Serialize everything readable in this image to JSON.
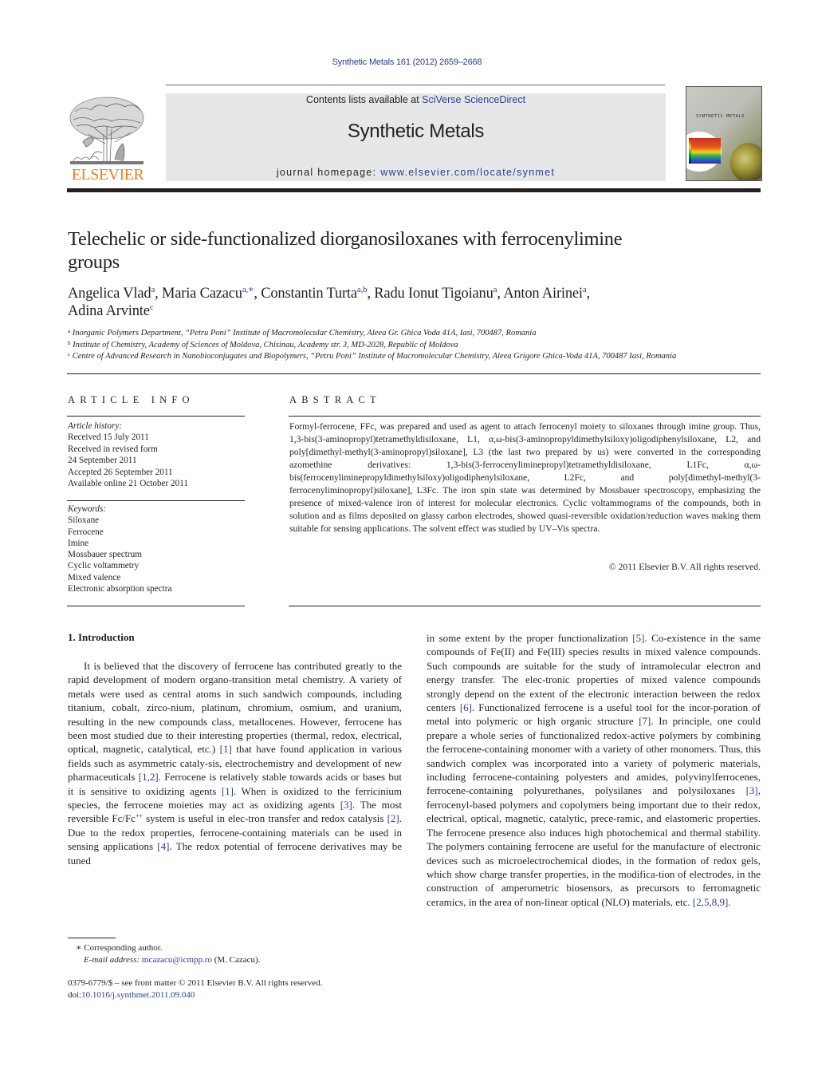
{
  "header": {
    "citation": "Synthetic Metals 161 (2012) 2659–2668",
    "contents_prefix": "Contents lists available at ",
    "contents_link": "SciVerse ScienceDirect",
    "journal_title": "Synthetic Metals",
    "homepage_prefix": "journal homepage: ",
    "homepage_link": "www.elsevier.com/locate/synmet",
    "publisher_logo_text": "ELSEVIER",
    "cover_title": "SYNTHETIC METALS",
    "colors": {
      "link": "#2a3d8f",
      "publisher_orange": "#f07f1f",
      "masthead_bg": "#e6e7e8"
    }
  },
  "article": {
    "title": "Telechelic or side-functionalized diorganosiloxanes with ferrocenylimine groups",
    "authors": [
      {
        "name": "Angelica Vlad",
        "aff": "a"
      },
      {
        "name": "Maria Cazacu",
        "aff": "a,∗"
      },
      {
        "name": "Constantin Turta",
        "aff": "a,b"
      },
      {
        "name": "Radu Ionut Tigoianu",
        "aff": "a"
      },
      {
        "name": "Anton Airinei",
        "aff": "a"
      },
      {
        "name": "Adina Arvinte",
        "aff": "c"
      }
    ],
    "affiliations": [
      {
        "mark": "a",
        "text": "Inorganic Polymers Department, “Petru Poni” Institute of Macromolecular Chemistry, Aleea Gr. Ghica Voda 41A, Iasi, 700487, Romania"
      },
      {
        "mark": "b",
        "text": "Institute of Chemistry, Academy of Sciences of Moldova, Chisinau, Academy str. 3, MD-2028, Republic of Moldova"
      },
      {
        "mark": "c",
        "text": "Centre of Advanced Research in Nanobioconjugates and Biopolymers, “Petru Poni” Institute of Macromolecular Chemistry, Aleea Grigore Ghica-Voda 41A, 700487 Iasi, Romania"
      }
    ]
  },
  "article_info": {
    "heading": "ARTICLE INFO",
    "history_label": "Article history:",
    "history": [
      "Received 15 July 2011",
      "Received in revised form",
      "24 September 2011",
      "Accepted 26 September 2011",
      "Available online 21 October 2011"
    ],
    "keywords_label": "Keywords:",
    "keywords": [
      "Siloxane",
      "Ferrocene",
      "Imine",
      "Mossbauer spectrum",
      "Cyclic voltammetry",
      "Mixed valence",
      "Electronic absorption spectra"
    ]
  },
  "abstract": {
    "heading": "ABSTRACT",
    "text": "Formyl-ferrocene, FFc, was prepared and used as agent to attach ferrocenyl moiety to siloxanes through imine group. Thus, 1,3-bis(3-aminopropyl)tetramethyldisiloxane, L1, α,ω-bis(3-aminopropyldimethylsiloxy)oligodiphenylsiloxane, L2, and poly[dimethyl-methyl(3-aminopropyl)siloxane], L3 (the last two prepared by us) were converted in the corresponding azomethine derivatives: 1,3-bis(3-ferrocenyliminepropyl)tetramethyldisiloxane, L1Fc, α,ω-bis(ferrocenyliminepropyldimethylsiloxy)oligodiphenylsiloxane, L2Fc, and poly[dimethyl-methyl(3-ferrocenyliminopropyl)siloxane], L3Fc. The iron spin state was determined by Mossbauer spectroscopy, emphasizing the presence of mixed-valence iron of interest for molecular electronics. Cyclic voltammograms of the compounds, both in solution and as films deposited on glassy carbon electrodes, showed quasi-reversible oxidation/reduction waves making them suitable for sensing applications. The solvent effect was studied by UV–Vis spectra.",
    "copyright": "© 2011 Elsevier B.V. All rights reserved."
  },
  "body": {
    "section_heading": "1.  Introduction",
    "left_segments": [
      {
        "t": "It is believed that the discovery of ferrocene has contributed greatly to the rapid development of modern organo-transition metal chemistry. A variety of metals were used as central atoms in such sandwich compounds, including titanium, cobalt, zirco-nium, platinum, chromium, osmium, and uranium, resulting in the new compounds class, metallocenes. However, ferrocene has been most studied due to their interesting properties (thermal, redox, electrical, optical, magnetic, catalytical, etc.) "
      },
      {
        "ref": "[1]"
      },
      {
        "t": " that have found application in various fields such as asymmetric cataly-sis, electrochemistry and development of new pharmaceuticals "
      },
      {
        "ref": "[1,2]"
      },
      {
        "t": ". Ferrocene is relatively stable towards acids or bases but it is sensitive to oxidizing agents "
      },
      {
        "ref": "[1]"
      },
      {
        "t": ". When is oxidized to the ferricinium species, the ferrocene moieties may act as oxidizing agents "
      },
      {
        "ref": "[3]"
      },
      {
        "t": ". The most reversible Fc/Fc"
      },
      {
        "sup": "++"
      },
      {
        "t": " system is useful in elec-tron transfer and redox catalysis "
      },
      {
        "ref": "[2]"
      },
      {
        "t": ". Due to the redox properties, ferrocene-containing materials can be used in sensing applications "
      },
      {
        "ref": "[4]"
      },
      {
        "t": ". The redox potential of ferrocene derivatives may be tuned"
      }
    ],
    "right_segments": [
      {
        "t": "in some extent by the proper functionalization "
      },
      {
        "ref": "[5]"
      },
      {
        "t": ". Co-existence in the same compounds of Fe(II) and Fe(III) species results in mixed valence compounds. Such compounds are suitable for the study of intramolecular electron and energy transfer. The elec-tronic properties of mixed valence compounds strongly depend on the extent of the electronic interaction between the redox centers "
      },
      {
        "ref": "[6]"
      },
      {
        "t": ". Functionalized ferrocene is a useful tool for the incor-poration of metal into polymeric or high organic structure "
      },
      {
        "ref": "[7]"
      },
      {
        "t": ". In principle, one could prepare a whole series of functionalized redox-active polymers by combining the ferrocene-containing monomer with a variety of other monomers. Thus, this sandwich complex was incorporated into a variety of polymeric materials, including ferrocene-containing polyesters and amides, polyvinylferrocenes, ferrocene-containing polyurethanes, polysilanes and polysiloxanes "
      },
      {
        "ref": "[3]"
      },
      {
        "t": ", ferrocenyl-based polymers and copolymers being important due to their redox, electrical, optical, magnetic, catalytic, prece-ramic, and elastomeric properties. The ferrocene presence also induces high photochemical and thermal stability. The polymers containing ferrocene are useful for the manufacture of electronic devices such as microelectrochemical diodes, in the formation of redox gels, which show charge transfer properties, in the modifica-tion of electrodes, in the construction of amperometric biosensors, as precursors to ferromagnetic ceramics, in the area of non-linear optical (NLO) materials, etc. "
      },
      {
        "ref": "[2,5,8,9]"
      },
      {
        "t": "."
      }
    ]
  },
  "footnotes": {
    "corresponding_mark": "∗",
    "corresponding_text": "Corresponding author.",
    "email_label": "E-mail address:",
    "email": "mcazacu@icmpp.ro",
    "email_suffix": " (M. Cazacu).",
    "front_matter": "0379-6779/$ – see front matter © 2011 Elsevier B.V. All rights reserved.",
    "doi_prefix": "doi:",
    "doi": "10.1016/j.synthmet.2011.09.040"
  }
}
